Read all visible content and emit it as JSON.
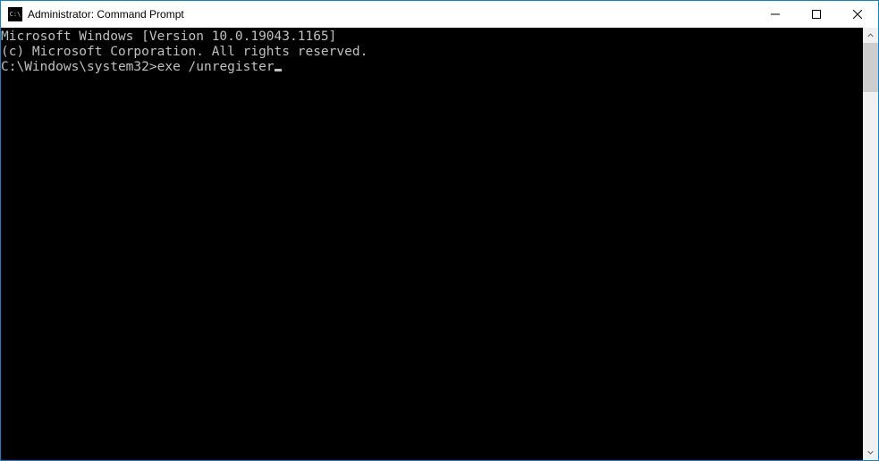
{
  "titlebar": {
    "title": "Administrator: Command Prompt"
  },
  "console": {
    "line1": "Microsoft Windows [Version 10.0.19043.1165]",
    "line2": "(c) Microsoft Corporation. All rights reserved.",
    "blank": "",
    "prompt": "C:\\Windows\\system32>",
    "command": "exe /unregister"
  }
}
